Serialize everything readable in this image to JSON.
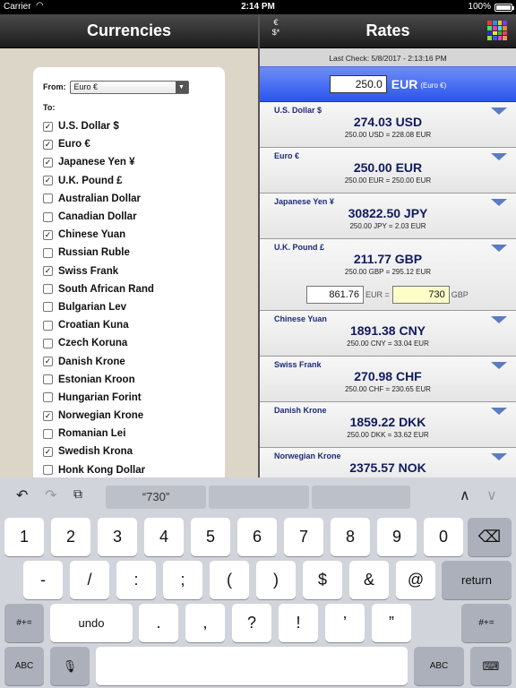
{
  "status": {
    "carrier": "Carrier",
    "time": "2:14 PM",
    "battery": "100%"
  },
  "left": {
    "title": "Currencies",
    "from_label": "From:",
    "from_value": "Euro €",
    "to_label": "To:",
    "currencies": [
      {
        "label": "U.S. Dollar $",
        "checked": true
      },
      {
        "label": "Euro €",
        "checked": true
      },
      {
        "label": "Japanese Yen ¥",
        "checked": true
      },
      {
        "label": "U.K. Pound £",
        "checked": true
      },
      {
        "label": "Australian Dollar",
        "checked": false
      },
      {
        "label": "Canadian Dollar",
        "checked": false
      },
      {
        "label": "Chinese Yuan",
        "checked": true
      },
      {
        "label": "Russian Ruble",
        "checked": false
      },
      {
        "label": "Swiss Frank",
        "checked": true
      },
      {
        "label": "South African Rand",
        "checked": false
      },
      {
        "label": "Bulgarian Lev",
        "checked": false
      },
      {
        "label": "Croatian Kuna",
        "checked": false
      },
      {
        "label": "Czech Koruna",
        "checked": false
      },
      {
        "label": "Danish Krone",
        "checked": true
      },
      {
        "label": "Estonian Kroon",
        "checked": false
      },
      {
        "label": "Hungarian Forint",
        "checked": false
      },
      {
        "label": "Norwegian Krone",
        "checked": true
      },
      {
        "label": "Romanian Lei",
        "checked": false
      },
      {
        "label": "Swedish Krona",
        "checked": true
      },
      {
        "label": "Honk Kong Dollar",
        "checked": false
      }
    ]
  },
  "right": {
    "title": "Rates",
    "swap_top": "€",
    "swap_bottom": "$*",
    "grid_colors": [
      "#e63a3a",
      "#3a8ae6",
      "#e6c93a",
      "#7a3ae6",
      "#3ae66c",
      "#e63ab8",
      "#3ae6e0",
      "#e68a3a",
      "#2a2ae6",
      "#e6e63a",
      "#3ab83a",
      "#e63a6a",
      "#8ae63a",
      "#3a5ae6",
      "#e63ae6",
      "#e6a03a"
    ],
    "last_check": "Last Check: 5/8/2017 - 2:13:16 PM",
    "amount": "250.0",
    "amount_currency": "EUR",
    "amount_currency_full": "(Euro €)",
    "rates": [
      {
        "name": "U.S. Dollar $",
        "value": "274.03 USD",
        "conv": "250.00 USD = 228.08 EUR"
      },
      {
        "name": "Euro €",
        "value": "250.00 EUR",
        "conv": "250.00 EUR = 250.00 EUR"
      },
      {
        "name": "Japanese Yen ¥",
        "value": "30822.50 JPY",
        "conv": "250.00 JPY = 2.03 EUR"
      },
      {
        "name": "U.K. Pound £",
        "value": "211.77 GBP",
        "conv": "250.00 GBP = 295.12 EUR",
        "expanded": true,
        "calc_left": "861.76",
        "calc_left_label": "EUR =",
        "calc_right": "730",
        "calc_right_label": "GBP"
      },
      {
        "name": "Chinese Yuan",
        "value": "1891.38 CNY",
        "conv": "250.00 CNY = 33.04 EUR"
      },
      {
        "name": "Swiss Frank",
        "value": "270.98 CHF",
        "conv": "250.00 CHF = 230.65 EUR"
      },
      {
        "name": "Danish Krone",
        "value": "1859.22 DKK",
        "conv": "250.00 DKK = 33.62 EUR"
      },
      {
        "name": "Norwegian Krone",
        "value": "2375.57 NOK",
        "conv": ""
      }
    ]
  },
  "keyboard": {
    "suggestion": "“730”",
    "row1": [
      "1",
      "2",
      "3",
      "4",
      "5",
      "6",
      "7",
      "8",
      "9",
      "0"
    ],
    "row2": [
      "-",
      "/",
      ":",
      ";",
      "(",
      ")",
      "$",
      "&",
      "@"
    ],
    "return": "return",
    "more_symbols": "#+=",
    "undo": "undo",
    "row3": [
      ".",
      ",",
      "?",
      "!",
      "’",
      "”"
    ],
    "abc": "ABC"
  }
}
